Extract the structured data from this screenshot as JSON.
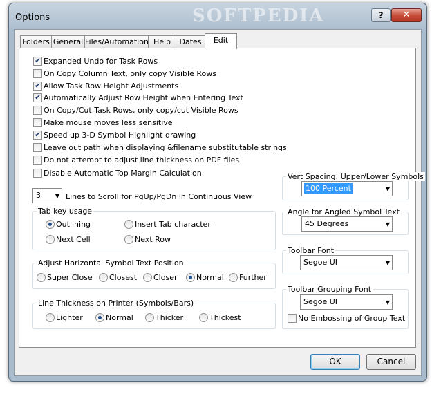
{
  "window": {
    "title": "Options",
    "watermark": "SOFTPEDIA",
    "help_label": "?",
    "close_label": "✕"
  },
  "tabs": [
    "Folders",
    "General",
    "Files/Automation",
    "Help",
    "Dates",
    "Edit"
  ],
  "checkboxes": [
    {
      "label": "Expanded Undo for Task Rows",
      "checked": true
    },
    {
      "label": "On Copy Column Text, only copy Visible Rows",
      "checked": false
    },
    {
      "label": "Allow Task Row Height Adjustments",
      "checked": true
    },
    {
      "label": "Automatically Adjust Row Height when Entering Text",
      "checked": true
    },
    {
      "label": "On Copy/Cut Task Rows, only copy/cut Visible Rows",
      "checked": false
    },
    {
      "label": "Make mouse moves less sensitive",
      "checked": false
    },
    {
      "label": "Speed up 3-D Symbol Highlight drawing",
      "checked": true
    },
    {
      "label": "Leave out path when displaying &filename substitutable strings",
      "checked": false
    },
    {
      "label": "Do not attempt to adjust line thickness on PDF files",
      "checked": false
    },
    {
      "label": "Disable Automatic Top Margin Calculation",
      "checked": false
    }
  ],
  "scroll": {
    "value": "3",
    "label": "Lines to Scroll for PgUp/PgDn in Continuous View"
  },
  "tab_key": {
    "title": "Tab key usage",
    "options": [
      "Outlining",
      "Insert Tab character",
      "Next Cell",
      "Next Row"
    ],
    "selected": "Outlining"
  },
  "horiz_pos": {
    "title": "Adjust Horizontal Symbol Text Position",
    "options": [
      "Super Close",
      "Closest",
      "Closer",
      "Normal",
      "Further"
    ],
    "selected": "Normal"
  },
  "line_thickness": {
    "title": "Line Thickness on Printer (Symbols/Bars)",
    "options": [
      "Lighter",
      "Normal",
      "Thicker",
      "Thickest"
    ],
    "selected": "Normal"
  },
  "vert_spacing": {
    "title": "Vert Spacing: Upper/Lower Symbols",
    "value": "100 Percent"
  },
  "angle": {
    "title": "Angle for Angled Symbol Text",
    "value": "45 Degrees"
  },
  "toolbar_font": {
    "title": "Toolbar Font",
    "value": "Segoe UI"
  },
  "grouping_font": {
    "title": "Toolbar Grouping Font",
    "value": "Segoe UI",
    "no_emboss_label": "No Embossing of Group Text",
    "no_emboss_checked": false
  },
  "buttons": {
    "ok": "OK",
    "cancel": "Cancel"
  },
  "colors": {
    "accent": "#1f4f8c",
    "selection": "#3399ff",
    "close": "#c44a36"
  }
}
